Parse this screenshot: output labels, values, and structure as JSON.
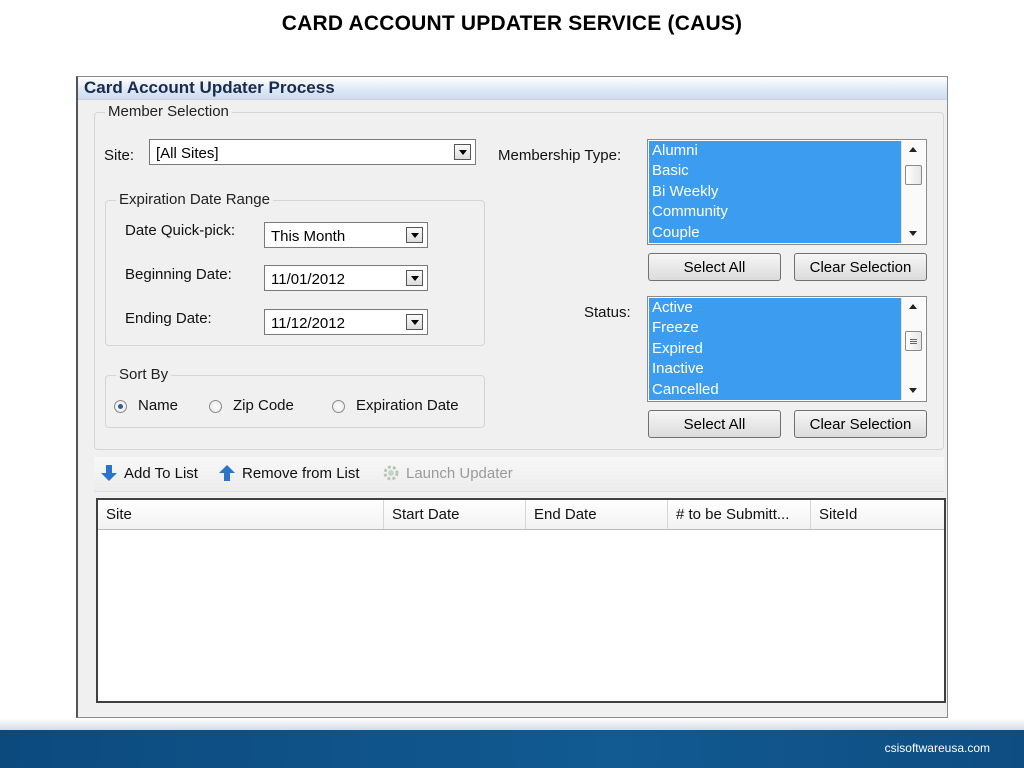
{
  "slide": {
    "title": "CARD ACCOUNT UPDATER SERVICE (CAUS)",
    "footer": "csisoftwareusa.com"
  },
  "window": {
    "title": "Card Account Updater Process"
  },
  "member_selection": {
    "legend": "Member Selection",
    "site_label": "Site:",
    "site_value": "[All Sites]",
    "membership_type_label": "Membership Type:",
    "membership_types": [
      "Alumni",
      "Basic",
      "Bi Weekly",
      "Community",
      "Couple"
    ],
    "status_label": "Status:",
    "statuses": [
      "Active",
      "Freeze",
      "Expired",
      "Inactive",
      "Cancelled"
    ],
    "select_all_label": "Select All",
    "clear_selection_label": "Clear Selection"
  },
  "expiration": {
    "legend": "Expiration Date Range",
    "quick_pick_label": "Date Quick-pick:",
    "quick_pick_value": "This Month",
    "beginning_label": "Beginning Date:",
    "beginning_value": "11/01/2012",
    "ending_label": "Ending Date:",
    "ending_value": "11/12/2012"
  },
  "sort_by": {
    "legend": "Sort By",
    "options": [
      "Name",
      "Zip Code",
      "Expiration Date"
    ],
    "selected": "Name"
  },
  "toolbar": {
    "add_label": "Add To List",
    "remove_label": "Remove from List",
    "launch_label": "Launch Updater"
  },
  "grid": {
    "columns": [
      "Site",
      "Start Date",
      "End Date",
      "# to be Submitt...",
      "SiteId"
    ],
    "rows": []
  },
  "icons": {
    "add": "arrow-down-icon",
    "remove": "arrow-up-icon",
    "launch": "gear-icon"
  },
  "colors": {
    "selection": "#3c9df0",
    "toolbar_arrow": "#2a74c9",
    "footer": "#0f5289"
  }
}
